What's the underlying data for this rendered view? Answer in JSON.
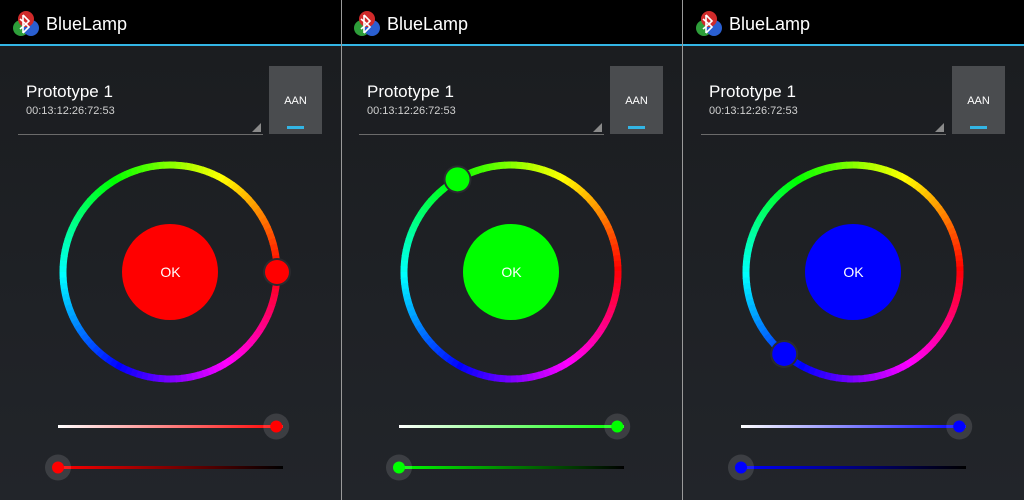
{
  "app": {
    "title": "BlueLamp",
    "icon": "bluetooth-lamp-icon"
  },
  "accent_color": "#33b5e5",
  "screens": [
    {
      "device": {
        "name": "Prototype 1",
        "address": "00:13:12:26:72:53"
      },
      "toggle_label": "AAN",
      "ok_label": "OK",
      "color": "#ff0000",
      "hue_deg": 0,
      "saturation": 0.97,
      "value": 0.0
    },
    {
      "device": {
        "name": "Prototype 1",
        "address": "00:13:12:26:72:53"
      },
      "toggle_label": "AAN",
      "ok_label": "OK",
      "color": "#00ff00",
      "hue_deg": 120,
      "saturation": 0.97,
      "value": 0.0
    },
    {
      "device": {
        "name": "Prototype 1",
        "address": "00:13:12:26:72:53"
      },
      "toggle_label": "AAN",
      "ok_label": "OK",
      "color": "#0000ff",
      "hue_deg": 230,
      "saturation": 0.97,
      "value": 0.0
    }
  ]
}
